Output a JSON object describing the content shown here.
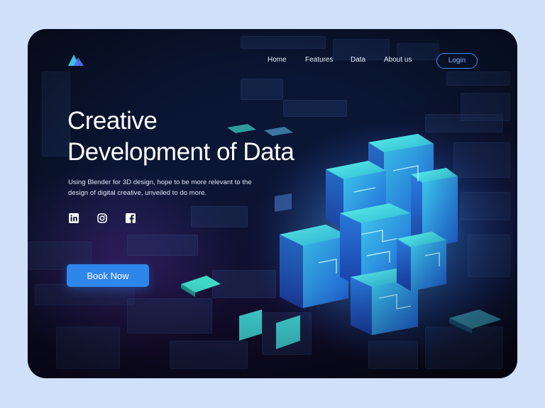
{
  "nav": {
    "items": [
      {
        "label": "Home"
      },
      {
        "label": "Features"
      },
      {
        "label": "Data"
      },
      {
        "label": "About us"
      }
    ],
    "login_label": "Login"
  },
  "hero": {
    "title_line1": "Creative",
    "title_line2": "Development of Data",
    "description": "Using Blender for 3D design, hope to be more relevant to the design of digital creative, unveiled to do more.",
    "cta_label": "Book Now"
  },
  "socials": [
    "linkedin-icon",
    "instagram-icon",
    "facebook-icon"
  ],
  "colors": {
    "accent": "#2f86ea",
    "login_border": "#3f8ff0",
    "background": "#cfe0f8",
    "card_dark": "#0b1430",
    "cube_cyan": "#3fd6e0"
  }
}
